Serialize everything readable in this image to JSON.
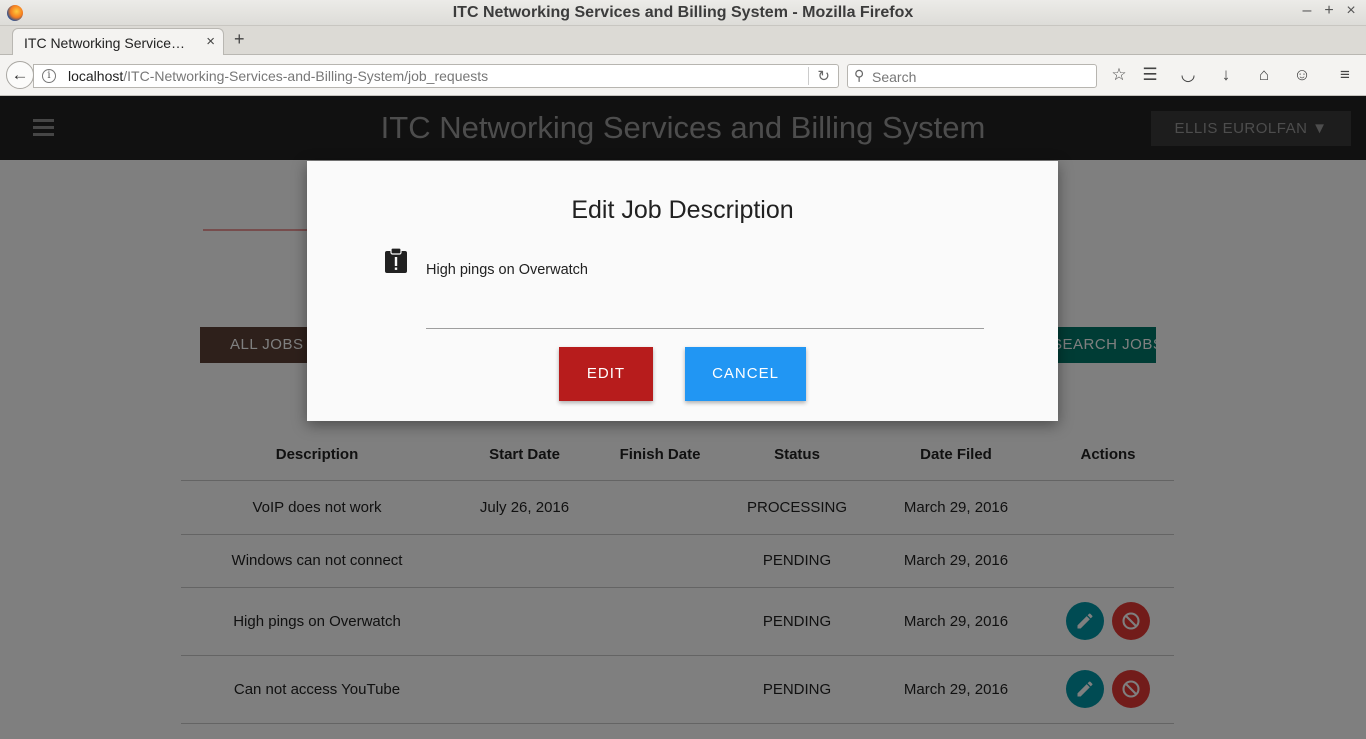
{
  "window": {
    "title": "ITC Networking Services and Billing System - Mozilla Firefox",
    "controls": {
      "minimize": "–",
      "maximize": "+",
      "close": "×"
    }
  },
  "tab": {
    "title": "ITC Networking Service…",
    "close": "×",
    "new_tab": "+"
  },
  "navbar": {
    "url_host": "localhost",
    "url_path": "/ITC-Networking-Services-and-Billing-System/job_requests",
    "search_placeholder": "Search"
  },
  "app": {
    "title": "ITC Networking Services and Billing System",
    "user_menu": "ELLIS EUROLFAN ▼"
  },
  "toolbar": {
    "all_jobs": "ALL JOBS",
    "search_jobs": "SEARCH JOBS…"
  },
  "table": {
    "headers": [
      "Description",
      "Start Date",
      "Finish Date",
      "Status",
      "Date Filed",
      "Actions"
    ],
    "rows": [
      {
        "description": "VoIP does not work",
        "start_date": "July 26, 2016",
        "finish_date": "",
        "status": "PROCESSING",
        "date_filed": "March 29, 2016",
        "actions": false
      },
      {
        "description": "Windows can not connect",
        "start_date": "",
        "finish_date": "",
        "status": "PENDING",
        "date_filed": "March 29, 2016",
        "actions": false
      },
      {
        "description": "High pings on Overwatch",
        "start_date": "",
        "finish_date": "",
        "status": "PENDING",
        "date_filed": "March 29, 2016",
        "actions": true
      },
      {
        "description": "Can not access YouTube",
        "start_date": "",
        "finish_date": "",
        "status": "PENDING",
        "date_filed": "March 29, 2016",
        "actions": true
      }
    ]
  },
  "modal": {
    "title": "Edit Job Description",
    "field_value": "High pings on Overwatch",
    "edit_label": "EDIT",
    "cancel_label": "CANCEL",
    "icon": "clipboard-alert-icon"
  },
  "colors": {
    "header_bg": "#222222",
    "edit_button": "#b71c1c",
    "cancel_button": "#2196f3",
    "status_processing": "#e6a23c",
    "status_pending": "#2196f3"
  }
}
